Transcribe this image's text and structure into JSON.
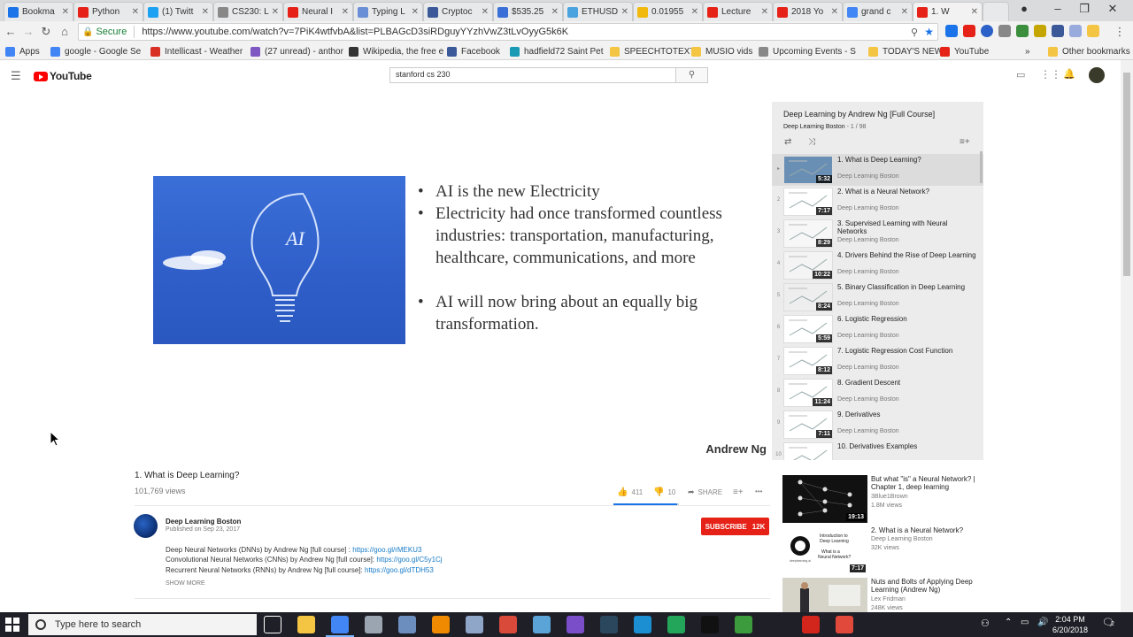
{
  "browser": {
    "tabs": [
      {
        "label": "Bookma",
        "color": "#1a73e8"
      },
      {
        "label": "Python",
        "color": "#e62117"
      },
      {
        "label": "(1) Twitt",
        "color": "#1da1f2"
      },
      {
        "label": "CS230: L",
        "color": "#888888"
      },
      {
        "label": "Neural I",
        "color": "#e62117"
      },
      {
        "label": "Typing L",
        "color": "#6b8fd6"
      },
      {
        "label": "Cryptoc",
        "color": "#3b5998"
      },
      {
        "label": "$535.25",
        "color": "#3b6fd8"
      },
      {
        "label": "ETHUSD",
        "color": "#4aa3df"
      },
      {
        "label": "0.01955",
        "color": "#f0b90b"
      },
      {
        "label": "Lecture",
        "color": "#e62117"
      },
      {
        "label": "2018 Yo",
        "color": "#e62117"
      },
      {
        "label": "grand c",
        "color": "#4285f4"
      },
      {
        "label": "1. W",
        "color": "#e62117"
      }
    ],
    "secure_label": "Secure",
    "url": "https://www.youtube.com/watch?v=7PiK4wtfvbA&list=PLBAGcD3siRDguyYYzhVwZ3tLvOyyG5k6K",
    "bookmarks": [
      {
        "label": "Apps",
        "color": "#4285f4"
      },
      {
        "label": "google - Google Se",
        "color": "#4285f4"
      },
      {
        "label": "Intellicast - Weather",
        "color": "#d93025"
      },
      {
        "label": "(27 unread) - anthor",
        "color": "#7e57c2"
      },
      {
        "label": "Wikipedia, the free e",
        "color": "#333333"
      },
      {
        "label": "Facebook",
        "color": "#3b5998"
      },
      {
        "label": "hadfield72 Saint Pet",
        "color": "#1a9bb5"
      },
      {
        "label": "SPEECHTOTEXT",
        "color": "#f4c542"
      },
      {
        "label": "MUSIO vids",
        "color": "#f4c542"
      },
      {
        "label": "Upcoming Events - S",
        "color": "#888888"
      },
      {
        "label": "TODAY'S NEWS",
        "color": "#f4c542"
      },
      {
        "label": "YouTube",
        "color": "#e62117"
      }
    ],
    "other_bookmarks": "Other bookmarks",
    "more_bookmarks": "»"
  },
  "youtube": {
    "logo_text": "YouTube",
    "search_value": "stanford cs 230",
    "search_icon": "search-icon"
  },
  "video": {
    "slide_bullets": [
      "AI is the new Electricity",
      "Electricity had once transformed countless industries: transportation, manufacturing, healthcare, communications, and more",
      "AI will now bring about an equally big transformation."
    ],
    "bulb_text": "AI",
    "author": "Andrew Ng",
    "title": "1. What is Deep Learning?",
    "views": "101,769 views",
    "likes": "411",
    "dislikes": "10",
    "like_ratio": 0.976,
    "share_label": "SHARE",
    "more_label": "•••",
    "channel": "Deep Learning Boston",
    "published": "Published on Sep 23, 2017",
    "subscribe_label": "SUBSCRIBE",
    "subscribers": "12K",
    "description": [
      {
        "text": "Deep Neural Networks (DNNs) by Andrew Ng [full course] : ",
        "link": "https://goo.gl/rMEKU3"
      },
      {
        "text": "Convolutional Neural Networks (CNNs) by Andrew Ng [full course]: ",
        "link": "https://goo.gl/C5y1Cj"
      },
      {
        "text": "Recurrent Neural Networks (RNNs) by Andrew Ng [full course]:  ",
        "link": "https://goo.gl/dTDH53"
      }
    ],
    "show_more": "SHOW MORE"
  },
  "playlist": {
    "title": "Deep Learning by Andrew Ng [Full Course]",
    "channel": "Deep Learning Boston",
    "position": " - 1 / 98",
    "items": [
      {
        "num": "▸",
        "title": "1. What is Deep Learning?",
        "channel": "Deep Learning Boston",
        "duration": "5:32",
        "selected": true
      },
      {
        "num": "2",
        "title": "2. What is a Neural Network?",
        "channel": "Deep Learning Boston",
        "duration": "7:17",
        "selected": false
      },
      {
        "num": "3",
        "title": "3. Supervised Learning with Neural Networks",
        "channel": "Deep Learning Boston",
        "duration": "8:29",
        "selected": false
      },
      {
        "num": "4",
        "title": "4. Drivers Behind the Rise of Deep Learning",
        "channel": "Deep Learning Boston",
        "duration": "10:22",
        "selected": false
      },
      {
        "num": "5",
        "title": "5. Binary Classification in Deep Learning",
        "channel": "Deep Learning Boston",
        "duration": "8:24",
        "selected": false
      },
      {
        "num": "6",
        "title": "6. Logistic Regression",
        "channel": "Deep Learning Boston",
        "duration": "5:59",
        "selected": false
      },
      {
        "num": "7",
        "title": "7. Logistic Regression Cost Function",
        "channel": "Deep Learning Boston",
        "duration": "8:12",
        "selected": false
      },
      {
        "num": "8",
        "title": "8. Gradient Descent",
        "channel": "Deep Learning Boston",
        "duration": "11:24",
        "selected": false
      },
      {
        "num": "9",
        "title": "9. Derivatives",
        "channel": "Deep Learning Boston",
        "duration": "7:11",
        "selected": false
      },
      {
        "num": "10",
        "title": "10. Derivatives Examples",
        "channel": "Deep Learning Boston",
        "duration": "",
        "selected": false
      }
    ]
  },
  "recommendations": [
    {
      "title": "But what \"is\" a Neural Network? | Chapter 1, deep learning",
      "channel": "3Blue1Brown",
      "views": "1.8M views",
      "duration": "19:13",
      "bg": "#111111"
    },
    {
      "title": "2. What is a Neural Network?",
      "channel": "Deep Learning Boston",
      "views": "32K views",
      "duration": "7:17",
      "bg": "#ffffff",
      "thumb_lines": [
        "Introduction to",
        "Deep Learning",
        "What is a",
        "Neural Network?"
      ],
      "thumb_small": "deeplearning.ai"
    },
    {
      "title": "Nuts and Bolts of Applying Deep Learning (Andrew Ng)",
      "channel": "Lex Fridman",
      "views": "248K views",
      "duration": "",
      "bg": "#d8d8d0"
    }
  ],
  "taskbar": {
    "search_placeholder": "Type here to search",
    "time": "2:04 PM",
    "date": "6/20/2018",
    "notifications": "2"
  }
}
